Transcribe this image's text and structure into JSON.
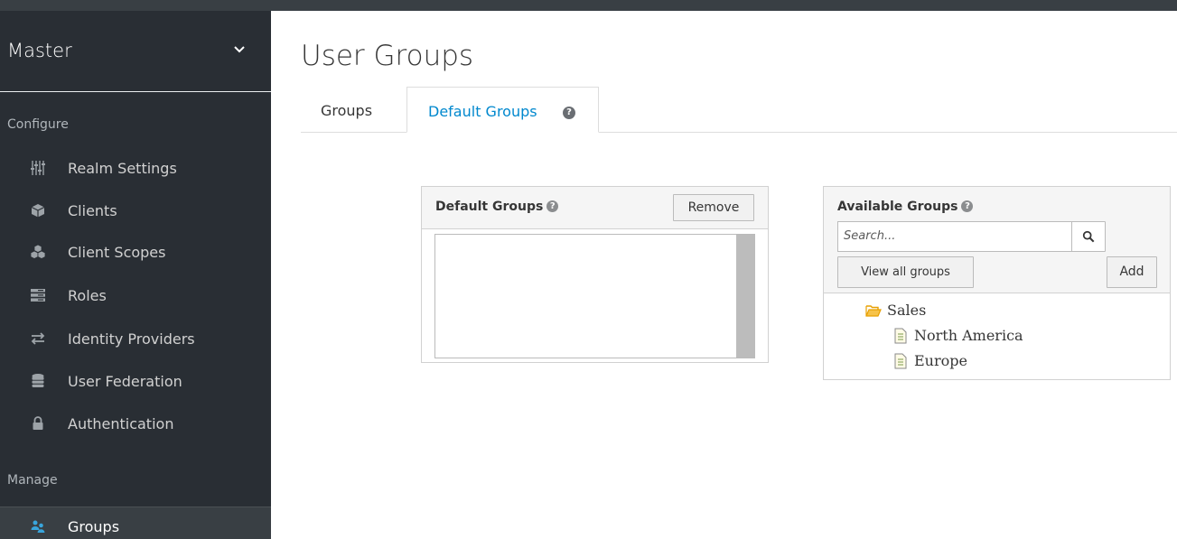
{
  "sidebar": {
    "realm": "Master",
    "configure_label": "Configure",
    "manage_label": "Manage",
    "configure_items": [
      {
        "label": "Realm Settings",
        "icon": "sliders-icon"
      },
      {
        "label": "Clients",
        "icon": "cube-icon"
      },
      {
        "label": "Client Scopes",
        "icon": "cubes-icon"
      },
      {
        "label": "Roles",
        "icon": "list-icon"
      },
      {
        "label": "Identity Providers",
        "icon": "exchange-icon"
      },
      {
        "label": "User Federation",
        "icon": "database-icon"
      },
      {
        "label": "Authentication",
        "icon": "lock-icon"
      }
    ],
    "manage_items": [
      {
        "label": "Groups",
        "icon": "users-icon",
        "active": true
      }
    ]
  },
  "main": {
    "title": "User Groups",
    "tabs": [
      {
        "label": "Groups",
        "active": false
      },
      {
        "label": "Default Groups",
        "active": true
      }
    ],
    "default_groups": {
      "title": "Default Groups",
      "remove_label": "Remove",
      "items": []
    },
    "available_groups": {
      "title": "Available Groups",
      "search_placeholder": "Search...",
      "view_all_label": "View all groups",
      "add_label": "Add",
      "tree": [
        {
          "label": "Sales",
          "type": "folder-open-icon",
          "children": [
            {
              "label": "North America",
              "type": "file-icon"
            },
            {
              "label": "Europe",
              "type": "file-icon"
            }
          ]
        }
      ]
    }
  },
  "colors": {
    "sidebar_bg": "#292e34",
    "active_item_bg": "#393f44",
    "link_blue": "#0088ce",
    "folder_orange": "#f0ab00"
  }
}
